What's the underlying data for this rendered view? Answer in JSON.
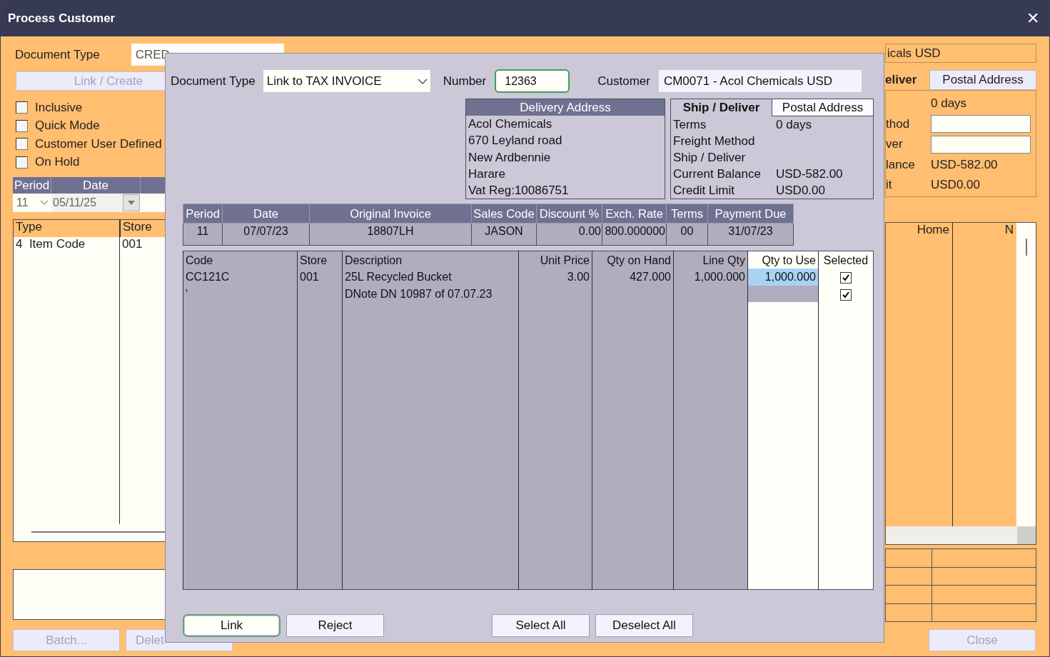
{
  "window": {
    "title": "Process Customer",
    "close": "✕"
  },
  "background_form": {
    "document_type": {
      "label": "Document Type",
      "value": "CRED"
    },
    "link_create_button": {
      "label": "Link / Create",
      "disabled": true
    },
    "options": [
      {
        "label": "Inclusive",
        "checked": false
      },
      {
        "label": "Quick Mode",
        "checked": false
      },
      {
        "label": "Customer User Defined",
        "checked": false
      },
      {
        "label": "On Hold",
        "checked": false
      }
    ],
    "period_grid": {
      "columns": [
        "Period",
        "Date"
      ],
      "period": "11",
      "date": "05/11/25"
    },
    "lines_list": {
      "columns": [
        "Type",
        "Store"
      ],
      "rows": [
        [
          "4  Item Code",
          "001"
        ]
      ]
    },
    "right_panel": {
      "customer_name": "icals USD",
      "tabs": [
        {
          "label": "eliver",
          "selected": true
        },
        {
          "label": "Postal Address",
          "selected": false
        }
      ],
      "info": [
        {
          "kind": "text",
          "value": "0 days"
        },
        {
          "kind": "field",
          "label": "thod"
        },
        {
          "kind": "field",
          "label": "ver"
        },
        {
          "kind": "text",
          "label": "lance",
          "value": "USD-582.00"
        },
        {
          "kind": "text",
          "label": "it",
          "value": "USD0.00"
        }
      ],
      "list_columns": [
        "Home",
        "N"
      ]
    },
    "buttons": [
      {
        "label": "Batch..."
      },
      {
        "label": "Delet"
      }
    ],
    "close_button": {
      "label": "Close"
    }
  },
  "dialog": {
    "document_type": {
      "label": "Document Type",
      "value": "Link to TAX INVOICE"
    },
    "number": {
      "label": "Number",
      "value": "12363"
    },
    "customer": {
      "label": "Customer",
      "value": "CM0071 - Acol Chemicals USD"
    },
    "delivery_address": {
      "title": "Delivery Address",
      "lines": [
        "Acol Chemicals",
        "670 Leyland road",
        "New Ardbennie",
        "Harare",
        "Vat Reg:10086751"
      ]
    },
    "account_tabs": [
      {
        "label": "Ship / Deliver",
        "selected": true
      },
      {
        "label": "Postal Address",
        "selected": false
      }
    ],
    "account_info": [
      {
        "label": "Terms",
        "value": "0 days"
      },
      {
        "label": "Freight Method"
      },
      {
        "label": "Ship / Deliver"
      },
      {
        "label": "Current Balance",
        "value": "USD-582.00"
      },
      {
        "label": "Credit Limit",
        "value": "USD0.00"
      }
    ],
    "invoice_table": {
      "columns": [
        "Period",
        "Date",
        "Original Invoice",
        "Sales Code",
        "Discount %",
        "Exch. Rate",
        "Terms",
        "Payment Due"
      ],
      "rows": [
        [
          "11",
          "07/07/23",
          "18807LH",
          "JASON",
          "0.00",
          "800.000000",
          "00",
          "31/07/23"
        ]
      ]
    },
    "lines_table": {
      "columns": [
        "Code",
        "Store",
        "Description",
        "Unit Price",
        "Qty on Hand",
        "Line Qty",
        "Qty to Use",
        "Selected"
      ],
      "rows": [
        {
          "code": "CC121C",
          "store": "001",
          "description": "25L Recycled Bucket",
          "unit_price": "3.00",
          "qty_on_hand": "427.000",
          "line_qty": "1,000.000",
          "qty_to_use": "1,000.000",
          "focused": true,
          "checked": true
        },
        {
          "code": "'",
          "description": "DNote DN 10987 of 07.07.23",
          "focused": false,
          "checked": true
        }
      ]
    },
    "buttons": [
      {
        "label": "Link",
        "focused": true
      },
      {
        "label": "Reject",
        "focused": false
      },
      {
        "label": "Select All",
        "focused": false
      },
      {
        "label": "Deselect All",
        "focused": false
      }
    ]
  }
}
